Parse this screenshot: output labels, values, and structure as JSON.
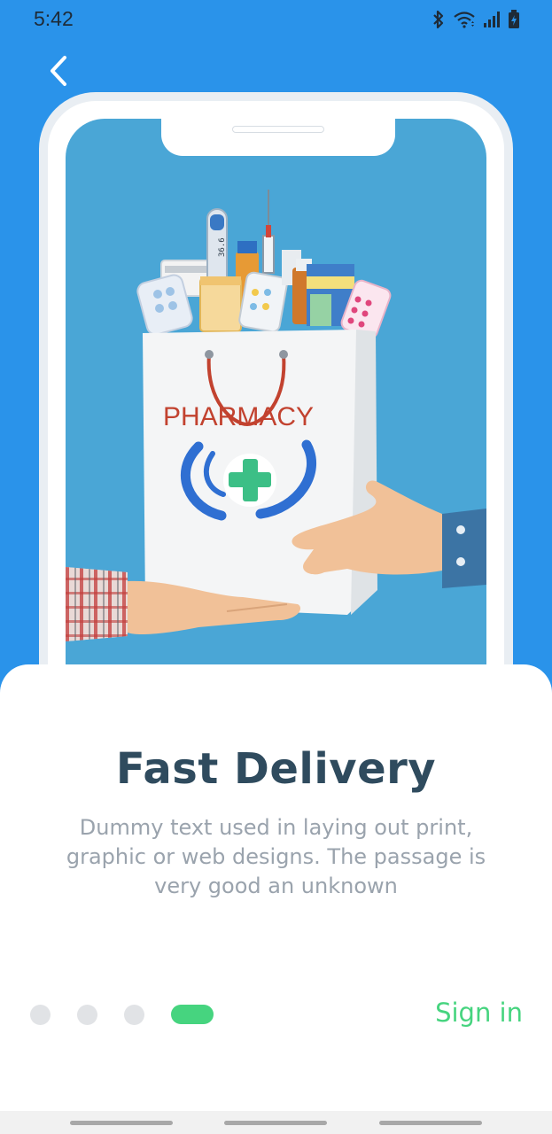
{
  "status_bar": {
    "time": "5:42",
    "icons": [
      "bluetooth-icon",
      "wifi-icon",
      "signal-icon",
      "battery-charging-icon"
    ]
  },
  "navigation": {
    "back_icon": "chevron-left-icon"
  },
  "illustration": {
    "bag_label": "PHARMACY",
    "thermometer_reading": "36.6",
    "colors": {
      "screen_background": "#4aa6d6",
      "bag_logo_blue": "#2f6fd2",
      "cross_green": "#3cbf86"
    }
  },
  "onboarding": {
    "title": "Fast Delivery",
    "description": "Dummy text used in laying out print, graphic or web designs. The passage is very good an unknown",
    "page_indicator": {
      "total": 4,
      "current": 4
    },
    "sign_in_label": "Sign in"
  },
  "colors": {
    "background": "#2a93ea",
    "accent": "#46d47f",
    "title": "#2f4b5e",
    "body_text": "#9aa3ad"
  }
}
